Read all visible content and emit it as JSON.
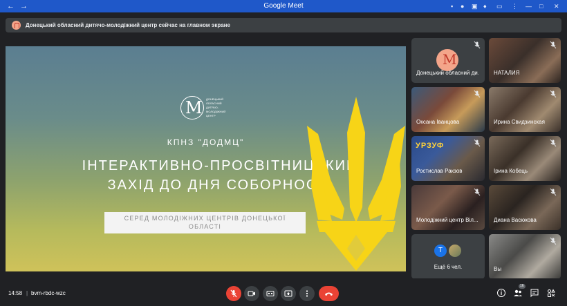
{
  "window": {
    "title": "Google Meet"
  },
  "banner": {
    "text": "Донецький обласний дитячо-молодіжний центр сейчас на главном экране"
  },
  "slide": {
    "logo_lines": [
      "ДОНЕЦЬКИЙ",
      "ОБЛАСНИЙ",
      "ДИТЯЧО-",
      "МОЛОДІЖНИЙ",
      "ЦЕНТР"
    ],
    "logo_letter": "M",
    "org": "КПНЗ \"ДОДМЦ\"",
    "heading_line1": "ІНТЕРАКТИВНО-ПРОСВІТНИЦЬКИЙ",
    "heading_line2": "ЗАХІД ДО ДНЯ СОБОРНОСТІ",
    "subtitle_line1": "СЕРЕД МОЛОДІЖНИХ ЦЕНТРІВ ДОНЕЦЬКОЇ",
    "subtitle_line2": "ОБЛАСТІ"
  },
  "participants": [
    {
      "name": "Донецький обласний ди...",
      "muted": true
    },
    {
      "name": "НАТАЛИЯ",
      "muted": true
    },
    {
      "name": "Оксана Іванцова",
      "muted": true
    },
    {
      "name": "Ирина Свидзинская",
      "muted": true
    },
    {
      "name": "Ростислав Ракзов",
      "muted": true
    },
    {
      "name": "Ірина Кобець",
      "muted": true
    },
    {
      "name": "Молодіжний центр Віл...",
      "muted": true
    },
    {
      "name": "Диана Васюкова",
      "muted": true
    },
    {
      "name": "Ещё 6 чел.",
      "avatar_letter": "T"
    },
    {
      "name": "Вы",
      "muted": true
    }
  ],
  "tile_texts": {
    "urzuf": "УРЗУФ"
  },
  "meeting": {
    "time": "14:58",
    "separator": "|",
    "code": "bvm-rbdc-wzc",
    "participant_count": "16"
  },
  "colors": {
    "titlebar": "#1f58c9",
    "background": "#202124",
    "tile": "#3c4043",
    "danger": "#ea4335",
    "trident": "#f7d417"
  }
}
